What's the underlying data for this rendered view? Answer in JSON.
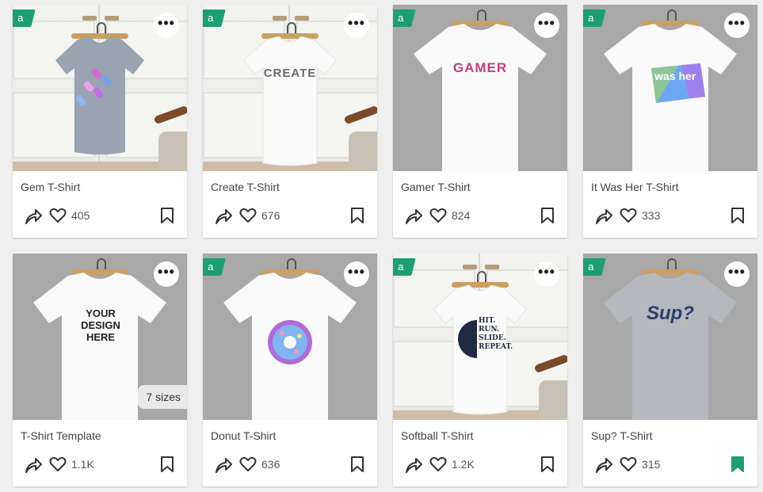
{
  "badge_letter": "a",
  "more_glyph": "•••",
  "accent_color": "#1d9e73",
  "products": [
    {
      "title": "Gem T-Shirt",
      "likes": "405",
      "bg": "door",
      "shirt_color": "#9aa3b0",
      "print": "",
      "saved": false
    },
    {
      "title": "Create T-Shirt",
      "likes": "676",
      "bg": "door",
      "shirt_color": "#fafafa",
      "print": "CREATE",
      "saved": false
    },
    {
      "title": "Gamer T-Shirt",
      "likes": "824",
      "bg": "gray",
      "shirt_color": "#fafafa",
      "print": "GAMER",
      "saved": false
    },
    {
      "title": "It Was Her T-Shirt",
      "likes": "333",
      "bg": "gray",
      "shirt_color": "#fafafa",
      "print": "It was her",
      "saved": false
    },
    {
      "title": "T-Shirt Template",
      "likes": "1.1K",
      "bg": "gray",
      "shirt_color": "#fafafa",
      "print": "YOUR DESIGN HERE",
      "sizes": "7 sizes",
      "saved": false
    },
    {
      "title": "Donut T-Shirt",
      "likes": "636",
      "bg": "gray",
      "shirt_color": "#fafafa",
      "print": "",
      "saved": false
    },
    {
      "title": "Softball T-Shirt",
      "likes": "1.2K",
      "bg": "door",
      "shirt_color": "#fafafa",
      "print": "HIT. RUN. SLIDE. REPEAT.",
      "saved": false
    },
    {
      "title": "Sup? T-Shirt",
      "likes": "315",
      "bg": "gray",
      "shirt_color": "#b5b8bd",
      "print": "Sup?",
      "saved": true
    }
  ]
}
